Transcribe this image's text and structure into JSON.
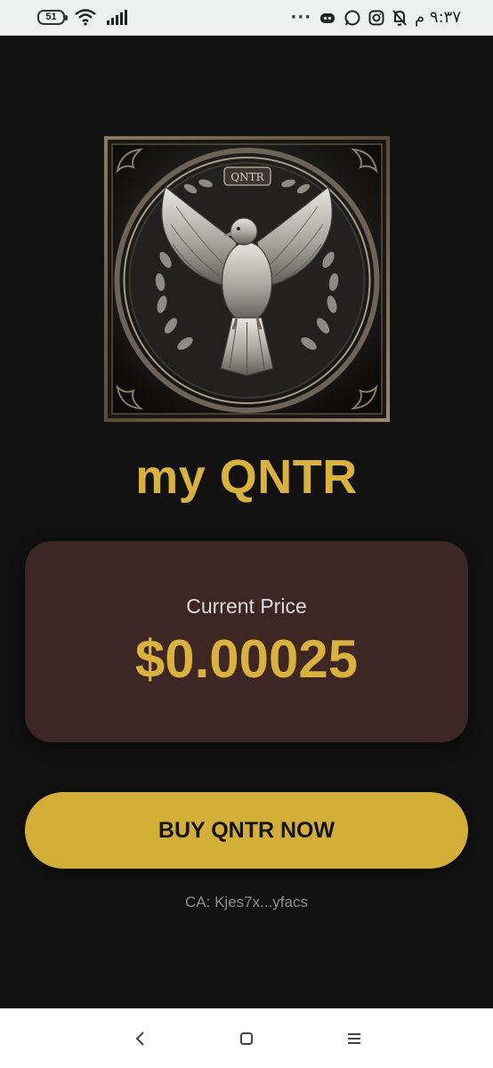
{
  "status_bar": {
    "battery_level": "51",
    "time": "٩:٣٧ م",
    "icons": [
      "wifi-icon",
      "signal-icon",
      "more-icon",
      "discord-icon",
      "whatsapp-icon",
      "instagram-icon",
      "mute-icon"
    ]
  },
  "app": {
    "logo_icon": "dove-emblem-icon",
    "logo_text": "QNTR",
    "title": "my QNTR",
    "price_label": "Current Price",
    "price_value": "$0.00025",
    "buy_button_label": "BUY QNTR NOW",
    "contract_address": "CA: Kjes7x...yfacs"
  },
  "nav_bar": {
    "icons": [
      "back-icon",
      "home-icon",
      "menu-icon"
    ]
  },
  "colors": {
    "background": "#121212",
    "accent_gold": "#d4af37",
    "card_bg": "#3e2625",
    "nav_bg": "#ffffff"
  }
}
